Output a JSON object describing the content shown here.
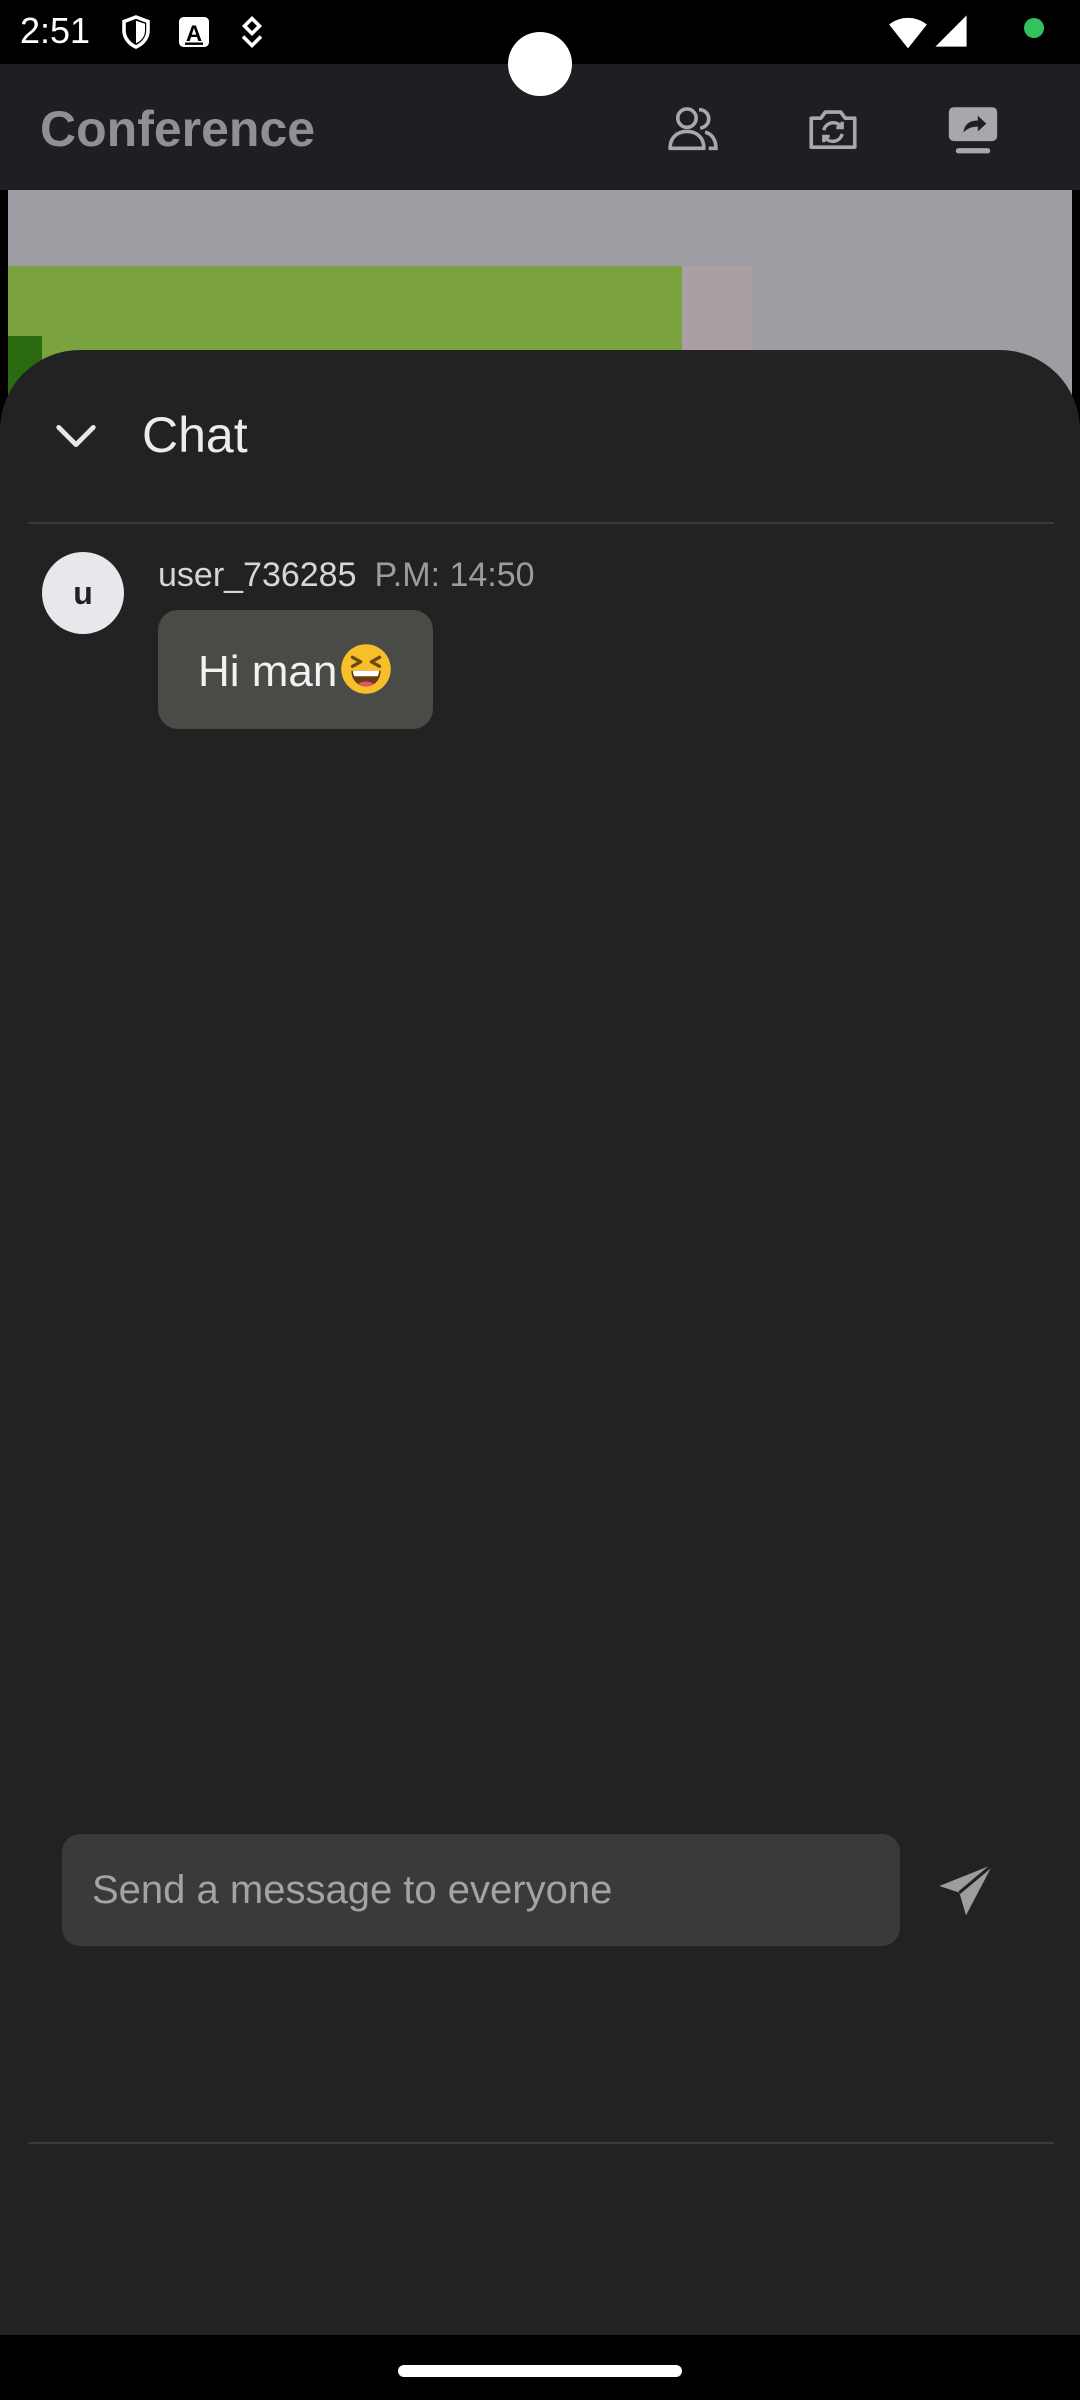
{
  "status_bar": {
    "time": "2:51",
    "icons": [
      "shield-icon",
      "a-badge-icon",
      "download-icon",
      "wifi-icon",
      "signal-icon",
      "privacy-dot-icon"
    ],
    "privacy_dot_color": "#33c25c"
  },
  "app_bar": {
    "title": "Conference",
    "actions": [
      "participants-icon",
      "switch-camera-icon",
      "screen-share-icon"
    ]
  },
  "chat_sheet": {
    "title": "Chat",
    "messages": [
      {
        "avatar_letter": "u",
        "user": "user_736285",
        "time": "P.M: 14:50",
        "text": "Hi man",
        "emoji": "grinning-squinting-face"
      }
    ],
    "input": {
      "placeholder": "Send a message to everyone",
      "value": ""
    }
  },
  "colors": {
    "sheet_background": "#222222",
    "bubble_background": "#4a4b46",
    "app_bar_background": "#1e1f22",
    "input_background": "#3a3a3a"
  }
}
